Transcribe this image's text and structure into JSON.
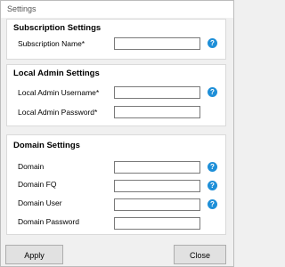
{
  "window": {
    "title": "Settings"
  },
  "subscription": {
    "title": "Subscription Settings",
    "name_label": "Subscription Name*",
    "name_value": ""
  },
  "local_admin": {
    "title": "Local Admin Settings",
    "username_label": "Local Admin Username*",
    "username_value": "",
    "password_label": "Local Admin Password*",
    "password_value": ""
  },
  "domain": {
    "title": "Domain Settings",
    "domain_label": "Domain",
    "domain_value": "",
    "fq_label": "Domain FQ",
    "fq_value": "",
    "user_label": "Domain User",
    "user_value": "",
    "password_label": "Domain Password",
    "password_value": ""
  },
  "help": {
    "glyph": "?",
    "icon_color": "#1e8fd8"
  },
  "buttons": {
    "apply": "Apply",
    "close": "Close"
  }
}
